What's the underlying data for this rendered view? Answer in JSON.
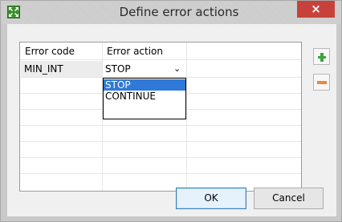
{
  "window": {
    "title": "Define error actions",
    "close_glyph": "×",
    "app_icon": "arrows-expand-icon"
  },
  "table": {
    "headers": [
      "Error code",
      "Error action"
    ],
    "rows": [
      {
        "code": "MIN_INT",
        "action": "STOP"
      }
    ]
  },
  "dropdown": {
    "selected": "STOP",
    "chevron": "⌄",
    "options": [
      "STOP",
      "CONTINUE"
    ],
    "highlighted": "STOP"
  },
  "side_buttons": {
    "add_icon": "plus-icon",
    "remove_icon": "minus-icon"
  },
  "buttons": {
    "ok": "OK",
    "cancel": "Cancel"
  },
  "colors": {
    "selection": "#2f79d8",
    "close": "#c7423a",
    "add": "#3aa53a",
    "remove": "#e8893a"
  }
}
